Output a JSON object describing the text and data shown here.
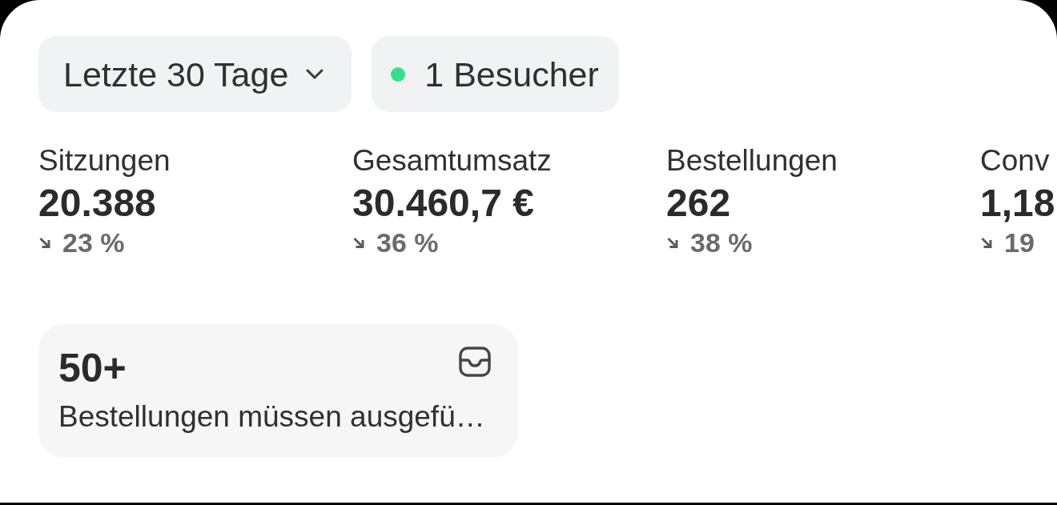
{
  "filters": {
    "date_range": {
      "label": "Letzte 30 Tage"
    },
    "visitors": {
      "label": "1 Besucher",
      "live": true
    }
  },
  "metrics": [
    {
      "label": "Sitzungen",
      "value": "20.388",
      "change": "23 %",
      "decrease": true
    },
    {
      "label": "Gesamtumsatz",
      "value": "30.460,7 €",
      "change": "36 %",
      "decrease": true
    },
    {
      "label": "Bestellungen",
      "value": "262",
      "change": "38 %",
      "decrease": true
    },
    {
      "label": "Conv",
      "value": "1,18",
      "change": "19",
      "decrease": true
    }
  ],
  "task_card": {
    "count": "50+",
    "text": "Bestellungen müssen ausgefü…"
  }
}
